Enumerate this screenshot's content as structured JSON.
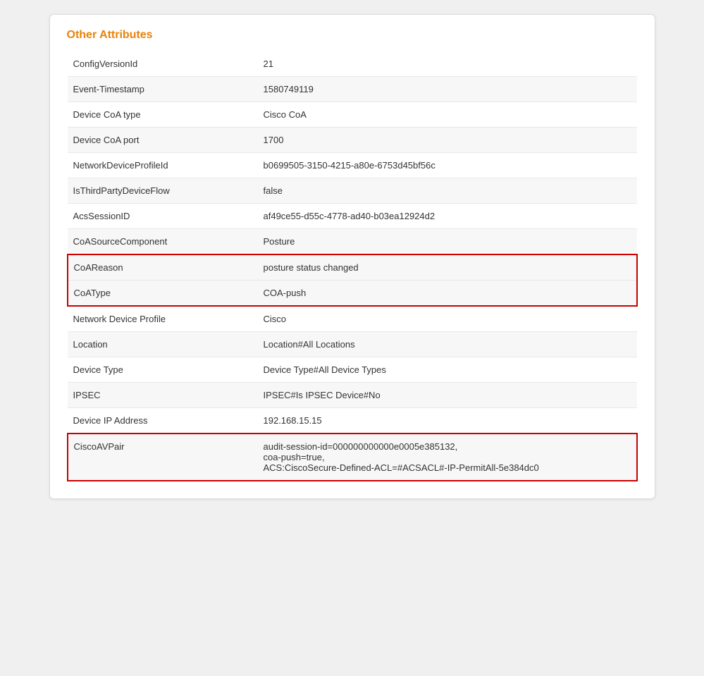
{
  "section": {
    "title": "Other Attributes"
  },
  "rows": [
    {
      "key": "ConfigVersionId",
      "value": "21",
      "highlight": false,
      "highlight_group": ""
    },
    {
      "key": "Event-Timestamp",
      "value": "1580749119",
      "highlight": false,
      "highlight_group": ""
    },
    {
      "key": "Device CoA type",
      "value": "Cisco CoA",
      "highlight": false,
      "highlight_group": ""
    },
    {
      "key": "Device CoA port",
      "value": "1700",
      "highlight": false,
      "highlight_group": ""
    },
    {
      "key": "NetworkDeviceProfileId",
      "value": "b0699505-3150-4215-a80e-6753d45bf56c",
      "highlight": false,
      "highlight_group": ""
    },
    {
      "key": "IsThirdPartyDeviceFlow",
      "value": "false",
      "highlight": false,
      "highlight_group": ""
    },
    {
      "key": "AcsSessionID",
      "value": "af49ce55-d55c-4778-ad40-b03ea12924d2",
      "highlight": false,
      "highlight_group": ""
    },
    {
      "key": "CoASourceComponent",
      "value": "Posture",
      "highlight": false,
      "highlight_group": ""
    },
    {
      "key": "CoAReason",
      "value": "posture status changed",
      "highlight": true,
      "highlight_group": "red-box-top"
    },
    {
      "key": "CoAType",
      "value": "COA-push",
      "highlight": true,
      "highlight_group": "red-box-bottom"
    },
    {
      "key": "Network Device Profile",
      "value": "Cisco",
      "highlight": false,
      "highlight_group": ""
    },
    {
      "key": "Location",
      "value": "Location#All Locations",
      "highlight": false,
      "highlight_group": ""
    },
    {
      "key": "Device Type",
      "value": "Device Type#All Device Types",
      "highlight": false,
      "highlight_group": ""
    },
    {
      "key": "IPSEC",
      "value": "IPSEC#Is IPSEC Device#No",
      "highlight": false,
      "highlight_group": ""
    },
    {
      "key": "Device IP Address",
      "value": "192.168.15.15",
      "highlight": false,
      "highlight_group": ""
    },
    {
      "key": "CiscoAVPair",
      "value": "audit-session-id=000000000000e0005e385132,\ncoa-push=true,\nACS:CiscoSecure-Defined-ACL=#ACSACL#-IP-PermitAll-5e384dc0",
      "highlight": true,
      "highlight_group": "red-box-single"
    }
  ]
}
